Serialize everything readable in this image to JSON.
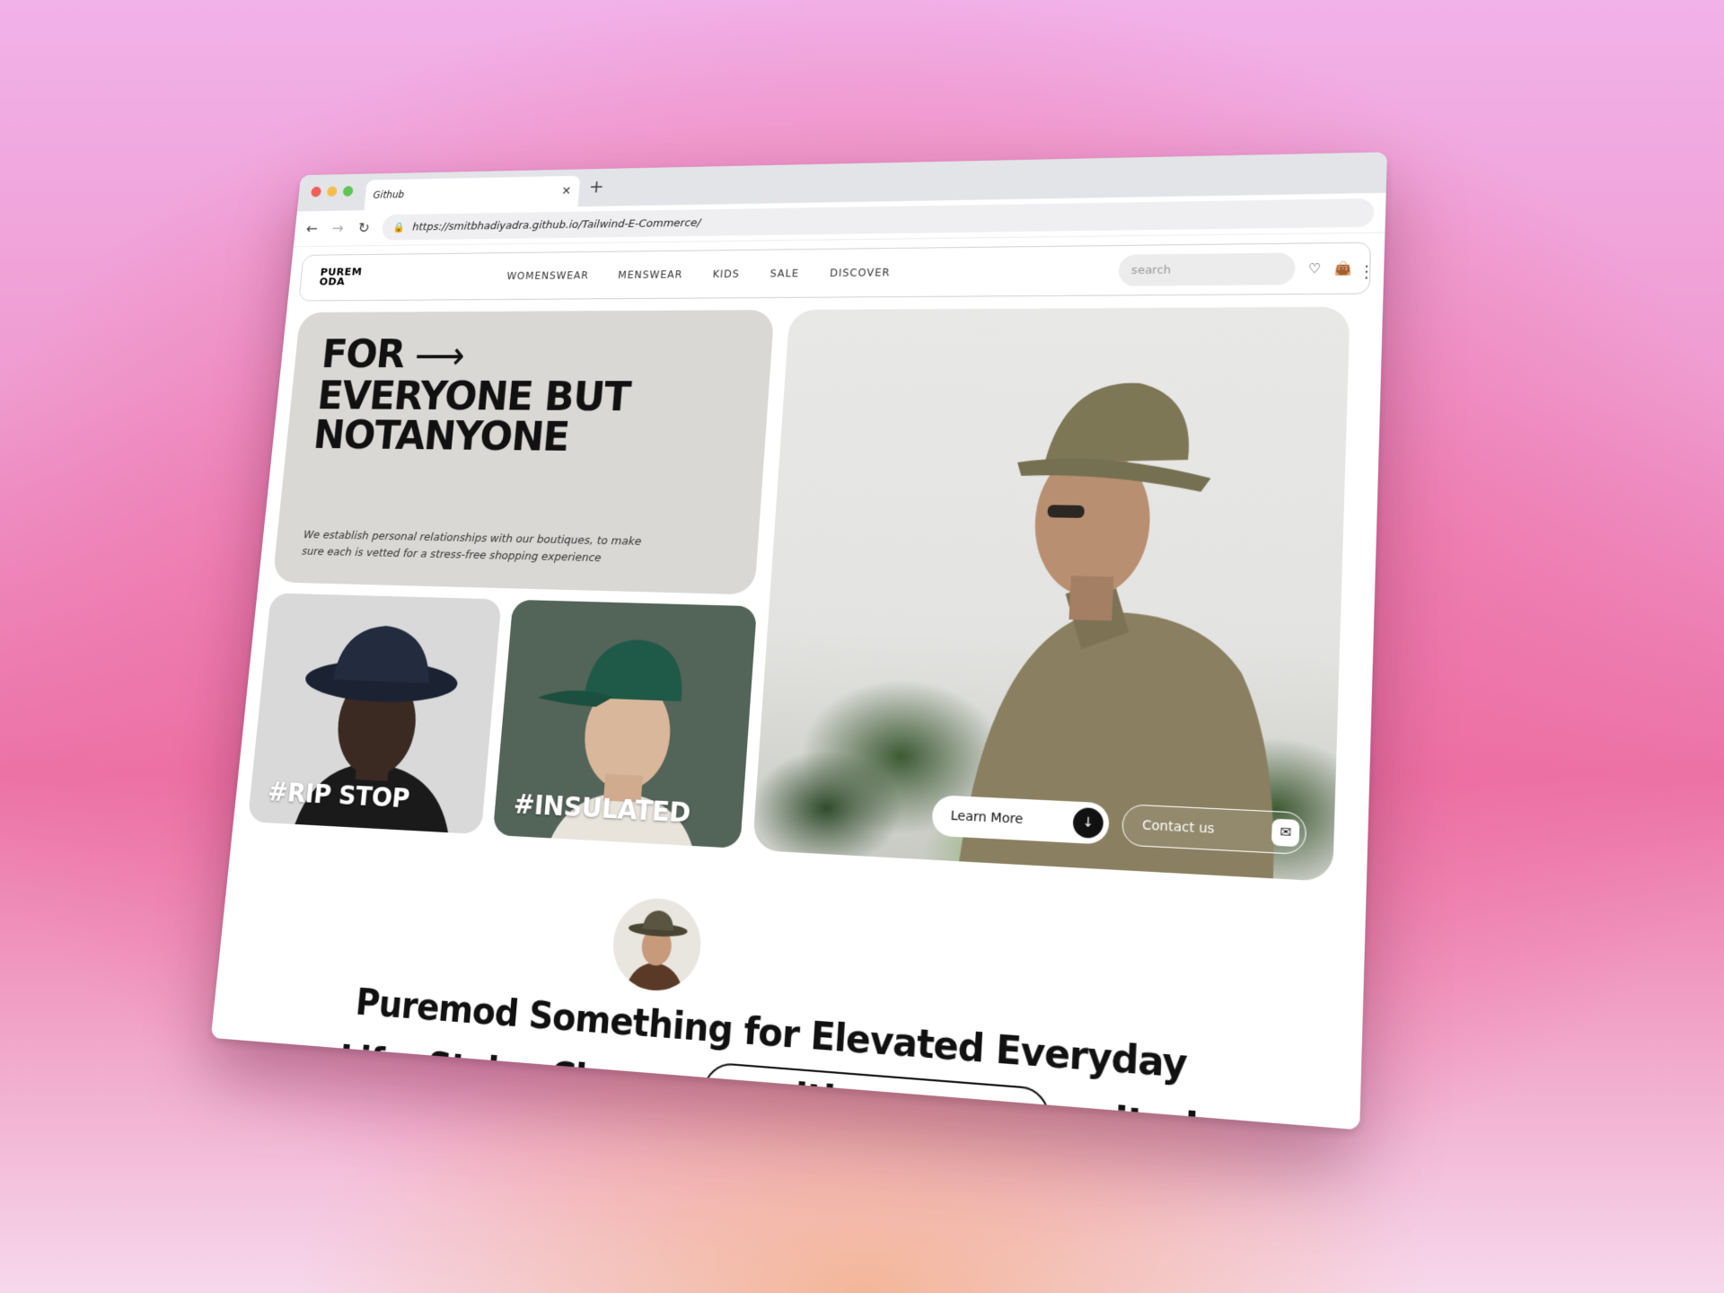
{
  "browser": {
    "tab_title": "Github",
    "url": "https://smitbhadiyadra.github.io/Tailwind-E-Commerce/"
  },
  "site": {
    "logo_line1": "PUREM",
    "logo_line2": "ODA",
    "nav": [
      "WOMENSWEAR",
      "MENSWEAR",
      "KIDS",
      "SALE",
      "DISCOVER"
    ],
    "search_placeholder": "search"
  },
  "hero": {
    "line1": "FOR",
    "line2": "EVERYONE BUT",
    "line3": "NOTANYONE",
    "subtitle": "We establish personal relationships with our boutiques, to make sure each is vetted for a stress-free shopping experience"
  },
  "tiles": [
    {
      "label": "#RIP STOP"
    },
    {
      "label": "#INSULATED"
    }
  ],
  "cta": {
    "learn_more": "Learn More",
    "contact": "Contact us"
  },
  "tagline": {
    "part1": "Puremod Something for Elevated Everyday",
    "part2": "Life. Styles Change",
    "pill": "with seasons",
    "part3": "united"
  }
}
